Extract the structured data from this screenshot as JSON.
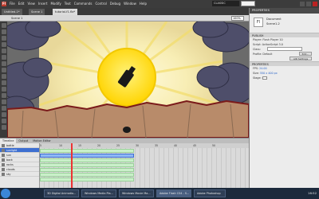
{
  "app": {
    "logo": "Fl"
  },
  "menu": [
    "File",
    "Edit",
    "View",
    "Insert",
    "Modify",
    "Text",
    "Commands",
    "Control",
    "Debug",
    "Window",
    "Help"
  ],
  "workspace": "CLASSIC",
  "tabs": [
    "Untitled-1*",
    "Scene 1",
    "tutorial-f1.fla*"
  ],
  "editbar": {
    "scene": "Scene 1",
    "zoom": "100%"
  },
  "timeline": {
    "tabs": [
      "Timeline",
      "Output",
      "Motion Editor"
    ],
    "ruler": [
      "5",
      "10",
      "15",
      "20",
      "25",
      "30",
      "35",
      "40",
      "45",
      "50"
    ],
    "layers": [
      "bottle",
      "sunlight",
      "sun",
      "back",
      "rocks",
      "clouds",
      "sky"
    ],
    "selected_layer": 1
  },
  "properties": {
    "title": "PROPERTIES",
    "doc_label": "Document",
    "doc_name": "Scene1-2",
    "publish": "PUBLISH",
    "player": "Player: Flash Player 10",
    "script": "Script: ActionScript 3.0",
    "class_label": "Class:",
    "profile": "Profile: Default",
    "edit": "Edit...",
    "air": "AIR Settings",
    "props": "PROPERTIES",
    "fps_label": "FPS:",
    "fps": "24.00",
    "size_label": "Size:",
    "size": "550 x 400 px",
    "stage_label": "Stage:"
  },
  "taskbar": [
    "3D Digital Animatio...",
    "Windows Media Pla...",
    "Windows Movie Ma...",
    "Adobe Flash CS4 - S...",
    "Adobe Photoshop"
  ],
  "clock": "16:52",
  "colors": {
    "sky": "#f4e9a6",
    "sun": "#ffe84a",
    "cloud": "#4e4e6a",
    "rock": "#b88b6a",
    "ridge": "#7a1a1a"
  }
}
